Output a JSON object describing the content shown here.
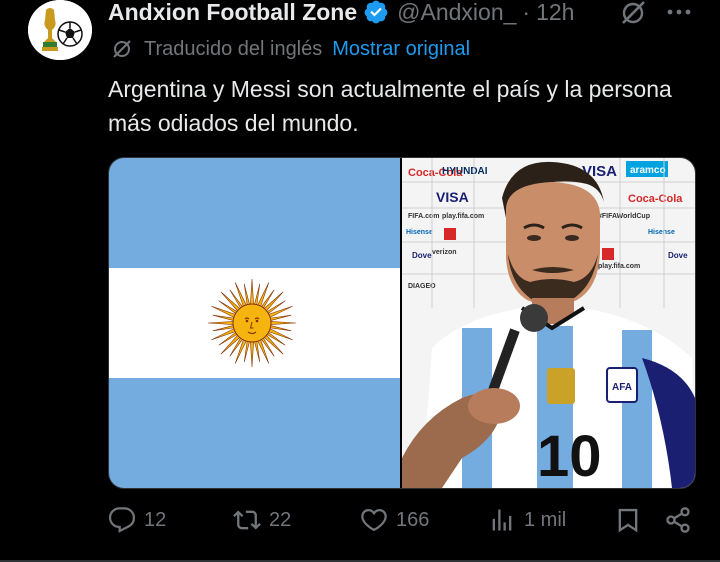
{
  "author": {
    "name": "Andxion Football Zone",
    "handle": "@Andxion_",
    "separator": "·",
    "time": "12h"
  },
  "translation": {
    "translated_label": "Traducido del inglés",
    "show_original_label": "Mostrar original"
  },
  "tweet": {
    "text": "Argentina y Messi son actualmente el país y la persona más odiados del mundo."
  },
  "actions": {
    "replies": "12",
    "reposts": "22",
    "likes": "166",
    "views": "1 mil"
  },
  "photo_signage": {
    "visa": "VISA",
    "aramco": "aramco",
    "hyundai": "HYUNDAI",
    "cocacola": "Coca-Cola",
    "fifa": "#FIFAWorldCup",
    "jersey_number": "10"
  },
  "colors": {
    "background": "#000000",
    "text": "#e7e9ea",
    "muted": "#71767b",
    "link": "#1d9bf0",
    "flag_blue": "#74acdf",
    "flag_sun": "#f6b40e"
  }
}
